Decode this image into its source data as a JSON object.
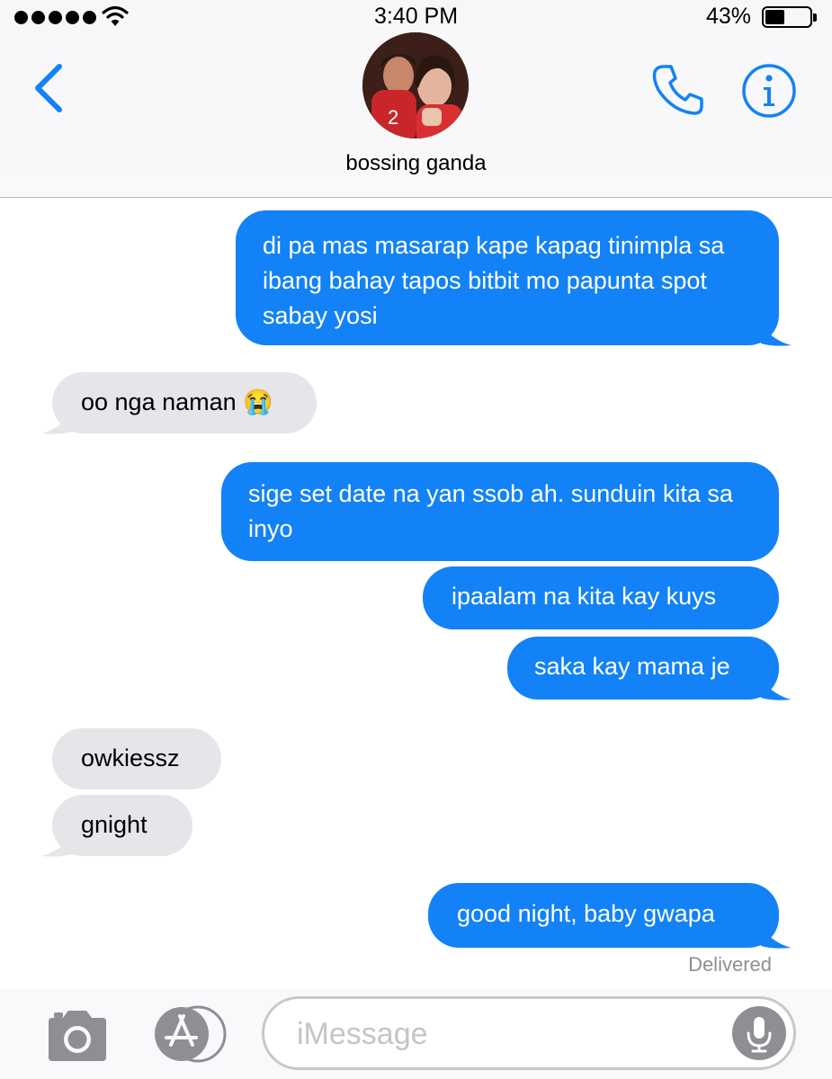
{
  "status_bar": {
    "time": "3:40 PM",
    "battery": "43%"
  },
  "contact": {
    "name": "bossing ganda"
  },
  "colors": {
    "sent": "#1382f6",
    "received": "#e5e5ea",
    "accent": "#1382f6"
  },
  "icons": {
    "back": "chevron-left-icon",
    "phone": "phone-icon",
    "info": "info-icon",
    "camera": "camera-icon",
    "apps": "app-store-icon",
    "mic": "microphone-icon"
  },
  "messages": [
    {
      "type": "sent",
      "text": "di pa mas masarap kape kapag tinimpla sa ibang bahay tapos bitbit mo papunta spot sabay yosi"
    },
    {
      "type": "received",
      "text": "oo nga naman 😭"
    },
    {
      "type": "sent",
      "text": "sige set date na yan ssob ah. sunduin kita sa inyo"
    },
    {
      "type": "sent",
      "text": "ipaalam na kita kay kuys"
    },
    {
      "type": "sent",
      "text": "saka kay mama je"
    },
    {
      "type": "received",
      "text": "owkiessz"
    },
    {
      "type": "received",
      "text": "gnight"
    },
    {
      "type": "sent",
      "text": "good night, baby gwapa"
    }
  ],
  "delivered_label": "Delivered",
  "input": {
    "placeholder": "iMessage",
    "value": ""
  }
}
